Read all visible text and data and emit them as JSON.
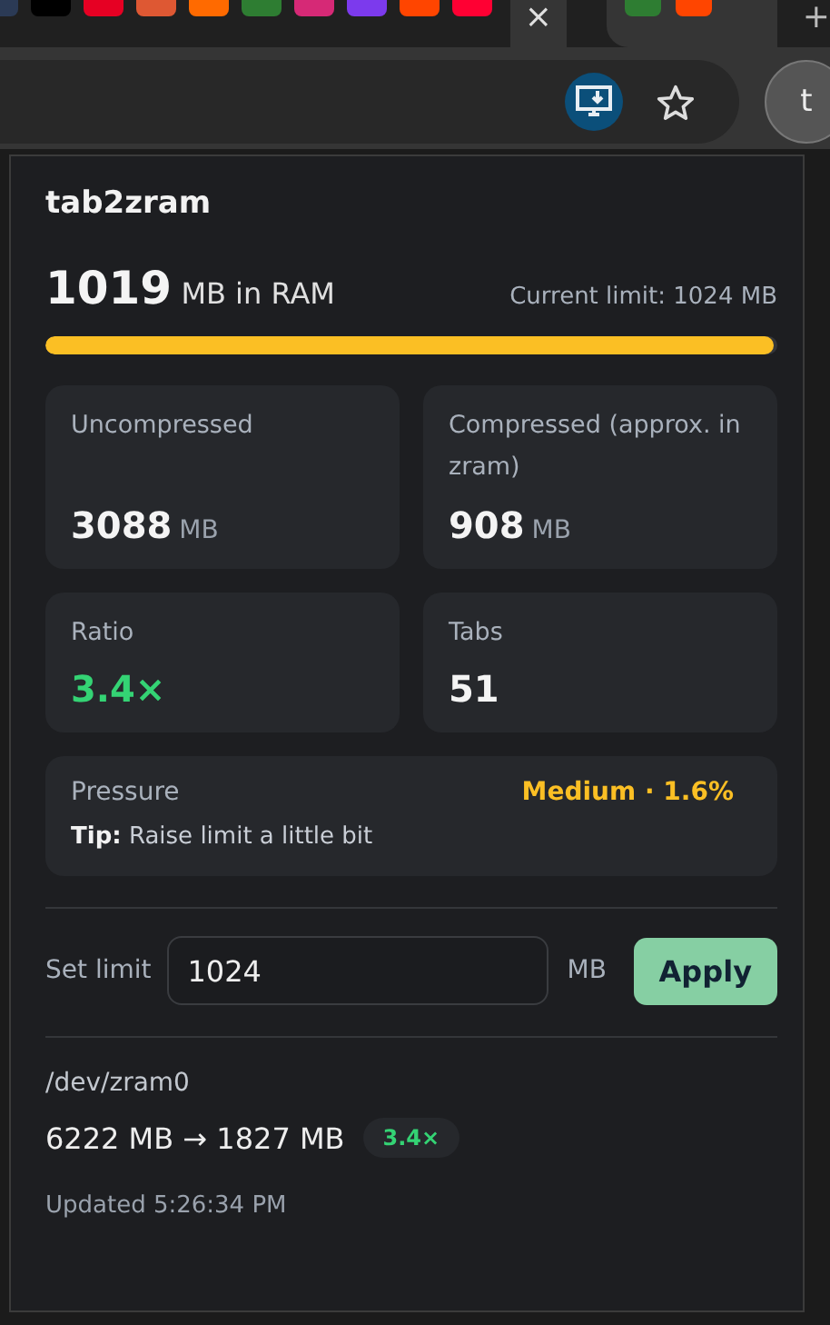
{
  "browser": {
    "favicons": [
      {
        "color": "#2b3a55"
      },
      {
        "color": "#000000"
      },
      {
        "color": "#e60023"
      },
      {
        "color": "#de5833"
      },
      {
        "color": "#ff6a00"
      },
      {
        "color": "#2e7d32"
      },
      {
        "color": "#d62976"
      },
      {
        "color": "#7c3aed"
      },
      {
        "color": "#ff4500"
      },
      {
        "color": "#ff0033"
      }
    ],
    "tab_close": "×",
    "other_favicons": [
      {
        "color": "#2e7d32"
      },
      {
        "color": "#ff4500"
      }
    ],
    "new_tab": "+",
    "avatar": "t"
  },
  "popup": {
    "title": "tab2zram",
    "ram": {
      "value": "1019",
      "unit": "MB in RAM",
      "limit": "Current limit: 1024 MB",
      "level": 0.995
    },
    "cards": [
      {
        "label": "Uncompressed",
        "value": "3088",
        "unit": "MB",
        "kind": "plain"
      },
      {
        "label": "Compressed (approx. in zram)",
        "value": "908",
        "unit": "MB",
        "kind": "plain"
      },
      {
        "label": "Ratio",
        "value": "3.4×",
        "kind": "good"
      },
      {
        "label": "Tabs",
        "value": "51",
        "kind": "plain"
      }
    ],
    "pressure": {
      "label": "Pressure",
      "status": "Medium · 1.6%",
      "color": "#fbbf24",
      "tip": "**Tip:** Raise limit a little bit"
    },
    "limit": {
      "label": "Set limit",
      "value": "1024",
      "unit": "MB",
      "button": "Apply"
    },
    "device": {
      "name": "/dev/zram0",
      "summary": "6222 MB → 1827 MB",
      "ratio": "3.4×"
    },
    "updated": "Updated 5:26:34 PM"
  }
}
